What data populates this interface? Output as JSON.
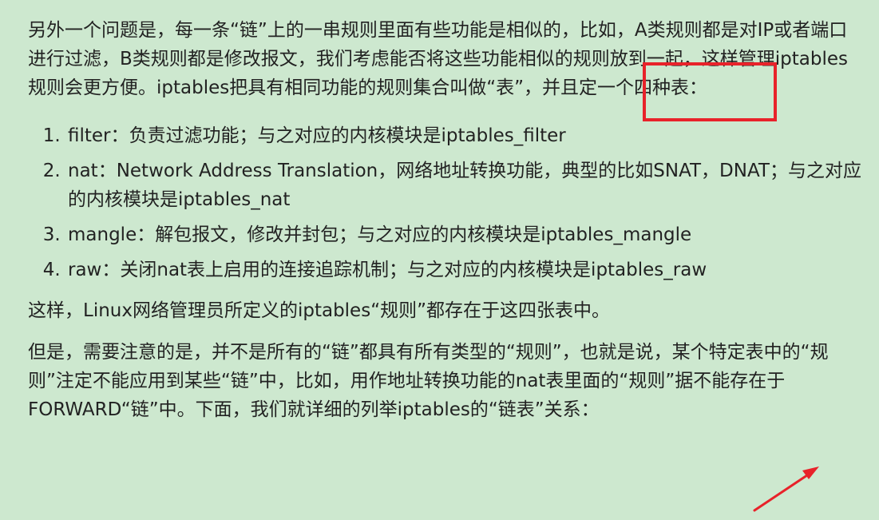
{
  "article": {
    "intro": "另外一个问题是，每一条“链”上的一串规则里面有些功能是相似的，比如，A类规则都是对IP或者端口进行过滤，B类规则都是修改报文，我们考虑能否将这些功能相似的规则放到一起，这样管理iptables规则会更方便。iptables把具有相同功能的规则集合叫做“表”，并且定一个四种表：",
    "tables": [
      {
        "text": "filter：负责过滤功能；与之对应的内核模块是iptables_filter"
      },
      {
        "text": "nat：Network Address Translation，网络地址转换功能，典型的比如SNAT，DNAT；与之对应的内核模块是iptables_nat"
      },
      {
        "text": "mangle：解包报文，修改并封包；与之对应的内核模块是iptables_mangle"
      },
      {
        "text": "raw：关闭nat表上启用的连接追踪机制；与之对应的内核模块是iptables_raw"
      }
    ],
    "summary": "这样，Linux网络管理员所定义的iptables“规则”都存在于这四张表中。",
    "note": "但是，需要注意的是，并不是所有的“链”都具有所有类型的“规则”，也就是说，某个特定表中的“规则”注定不能应用到某些“链”中，比如，用作地址转换功能的nat表里面的“规则”据不能存在于FORWARD“链”中。下面，我们就详细的列举iptables的“链表”关系："
  },
  "annotations": {
    "color": "#e8222a"
  }
}
